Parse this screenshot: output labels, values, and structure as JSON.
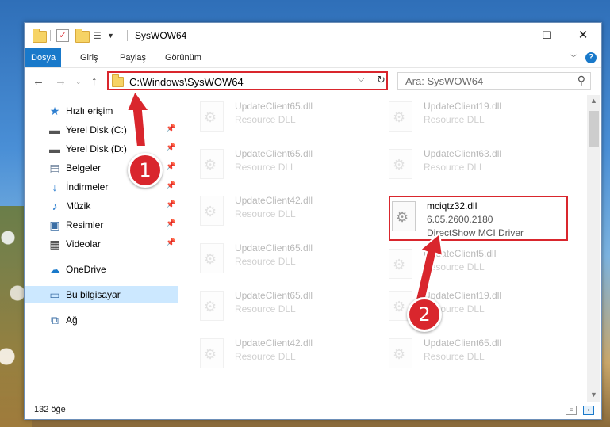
{
  "window": {
    "title": "SysWOW64"
  },
  "ribbon": {
    "tabs": [
      "Dosya",
      "Giriş",
      "Paylaş",
      "Görünüm"
    ],
    "active_tab": "Dosya",
    "help": "?"
  },
  "navbar": {
    "address": "C:\\Windows\\SysWOW64",
    "search_placeholder": "Ara: SysWOW64"
  },
  "sidebar": {
    "items": [
      {
        "label": "Hızlı erişim",
        "icon": "star-icon"
      },
      {
        "label": "Yerel Disk (C:)",
        "icon": "drive-icon",
        "pinned": true
      },
      {
        "label": "Yerel Disk (D:)",
        "icon": "drive-icon",
        "pinned": true
      },
      {
        "label": "Belgeler",
        "icon": "documents-icon",
        "pinned": true
      },
      {
        "label": "İndirmeler",
        "icon": "download-icon",
        "pinned": true
      },
      {
        "label": "Müzik",
        "icon": "music-icon",
        "pinned": true
      },
      {
        "label": "Resimler",
        "icon": "pictures-icon",
        "pinned": true
      },
      {
        "label": "Videolar",
        "icon": "video-icon",
        "pinned": true
      },
      {
        "label": "OneDrive",
        "icon": "cloud-icon"
      },
      {
        "label": "Bu bilgisayar",
        "icon": "computer-icon",
        "selected": true
      },
      {
        "label": "Ağ",
        "icon": "network-icon"
      }
    ]
  },
  "files": {
    "left": [
      {
        "name": "UpdateClient65.dll",
        "type": "Resource DLL"
      },
      {
        "name": "UpdateClient65.dll",
        "type": "Resource DLL"
      },
      {
        "name": "UpdateClient42.dll",
        "type": "Resource DLL"
      },
      {
        "name": "UpdateClient65.dll",
        "type": "Resource DLL"
      },
      {
        "name": "UpdateClient65.dll",
        "type": "Resource DLL"
      },
      {
        "name": "UpdateClient42.dll",
        "type": "Resource DLL"
      }
    ],
    "right": [
      {
        "name": "UpdateClient19.dll",
        "type": "Resource DLL"
      },
      {
        "name": "UpdateClient63.dll",
        "type": "Resource DLL"
      },
      {
        "name": "mciqtz32.dll",
        "version": "6.05.2600.2180",
        "type": "DirectShow MCI Driver"
      },
      {
        "name": "UpdateClient5.dll",
        "type": "Resource DLL"
      },
      {
        "name": "UpdateClient19.dll",
        "type": "Resource DLL"
      },
      {
        "name": "UpdateClient65.dll",
        "type": "Resource DLL"
      }
    ]
  },
  "status": {
    "count": "132 öğe"
  },
  "annotations": {
    "step1": "1",
    "step2": "2",
    "accent": "#d9262d"
  }
}
